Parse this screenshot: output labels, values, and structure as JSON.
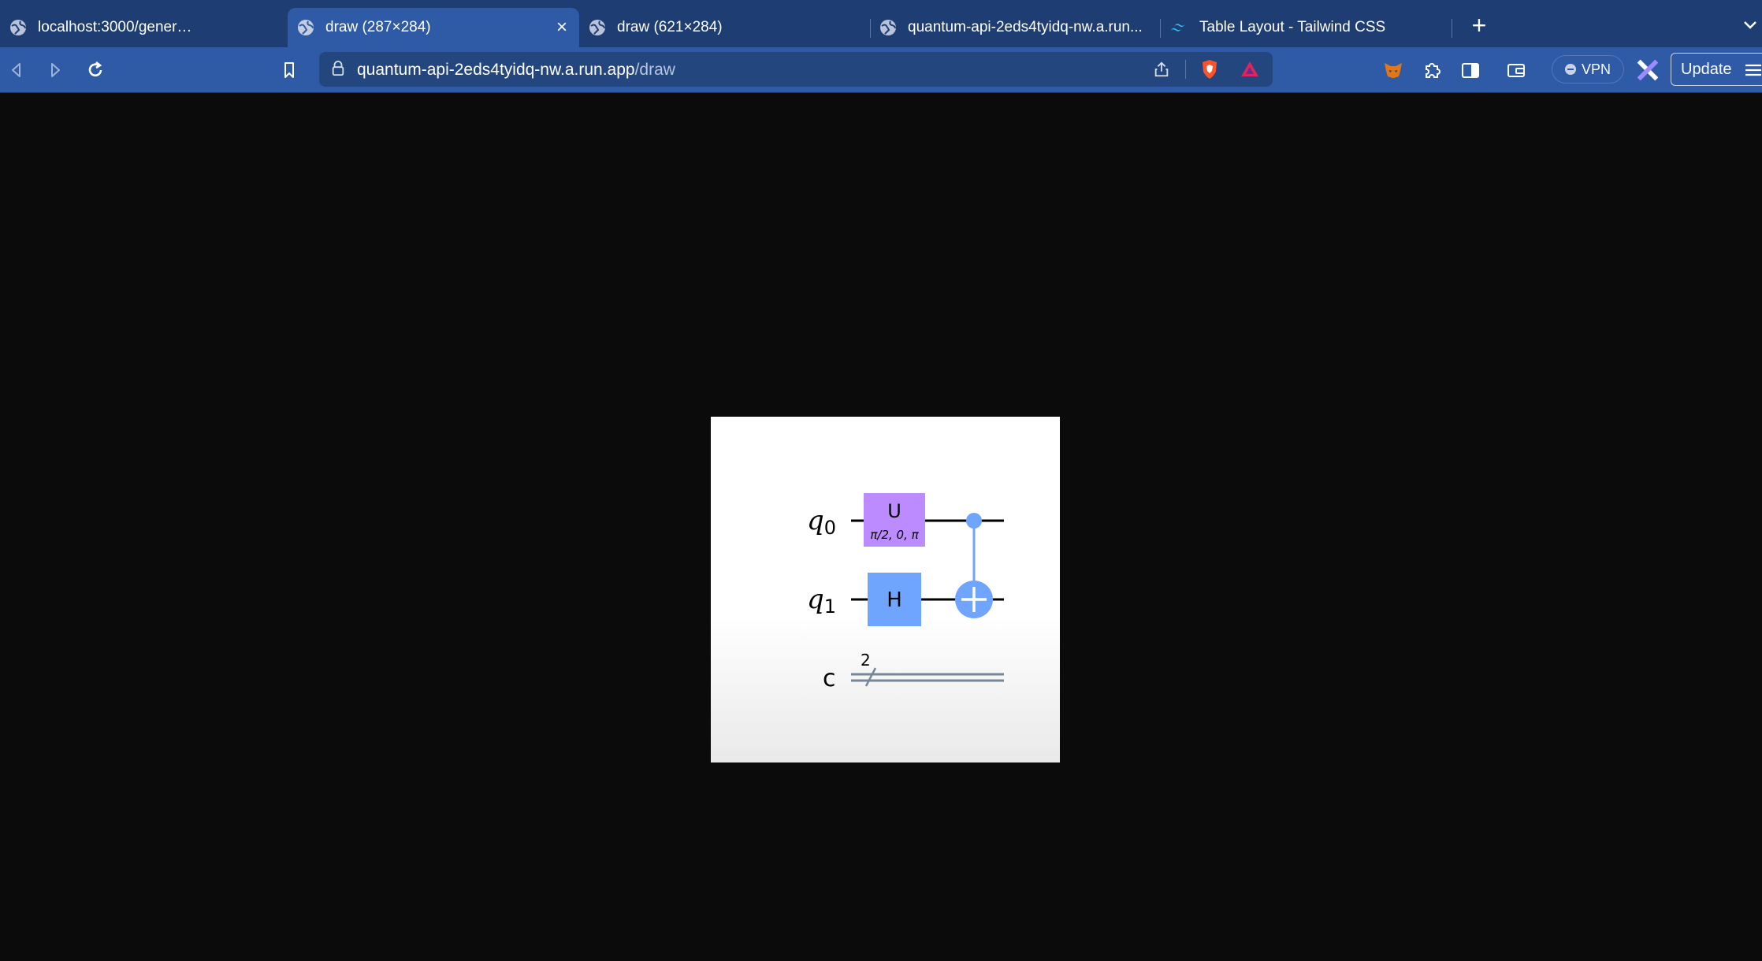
{
  "browser": {
    "tabs": [
      {
        "title": "localhost:3000/generateCircuit",
        "active": false,
        "icon": "globe-icon"
      },
      {
        "title": "draw (287×284)",
        "active": true,
        "icon": "globe-icon"
      },
      {
        "title": "draw (621×284)",
        "active": false,
        "icon": "globe-icon"
      },
      {
        "title": "quantum-api-2eds4tyidq-nw.a.run...",
        "active": false,
        "icon": "globe-icon"
      },
      {
        "title": "Table Layout - Tailwind CSS",
        "active": false,
        "icon": "tailwind-icon"
      }
    ],
    "new_tab_label": "+",
    "close_tab_label": "×",
    "address": {
      "host": "quantum-api-2eds4tyidq-nw.a.run.app",
      "path": "/draw"
    },
    "vpn_label": "VPN",
    "update_label": "Update",
    "colors": {
      "tab_strip": "#1e3d72",
      "toolbar": "#2e5aa6",
      "content_bg": "#0b0b0b"
    }
  },
  "circuit": {
    "qubit_labels": [
      {
        "symbol": "q",
        "subscript": "0"
      },
      {
        "symbol": "q",
        "subscript": "1"
      }
    ],
    "classical_label": "c",
    "classical_bits": "2",
    "gates": {
      "u": {
        "label": "U",
        "params": "π/2, 0, π",
        "color": "#bb8bff"
      },
      "h": {
        "label": "H",
        "color": "#6fa4ff"
      },
      "cx": {
        "color": "#6fa4ff"
      }
    }
  }
}
